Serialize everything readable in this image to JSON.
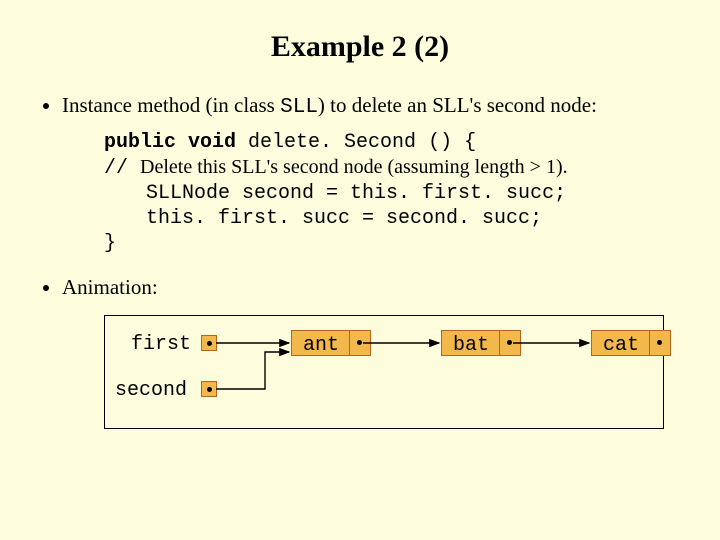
{
  "title": "Example 2 (2)",
  "bullet1_pre": "Instance method (in class ",
  "bullet1_code": "SLL",
  "bullet1_post": ") to delete an SLL's second node:",
  "code": {
    "sig1": "public void",
    "sig2": " delete. Second () {",
    "comment_prefix": "// ",
    "comment": "Delete this SLL's second node (assuming length > 1).",
    "l3": "SLLNode second = this. first. succ;",
    "l4": "this. first. succ = second. succ;",
    "l5": "}"
  },
  "bullet2": "Animation:",
  "anim": {
    "first": "first",
    "second": "second",
    "n1": "ant",
    "n2": "bat",
    "n3": "cat"
  }
}
